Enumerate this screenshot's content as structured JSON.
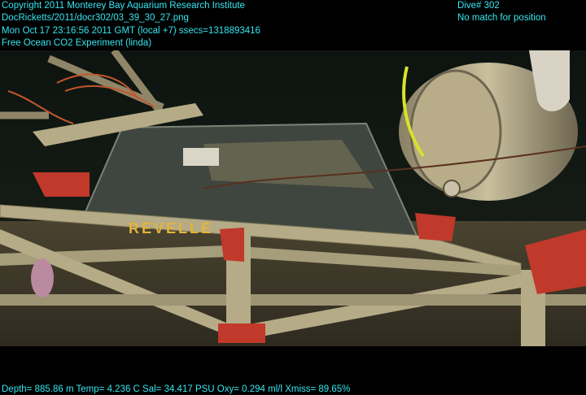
{
  "overlay": {
    "copyright": "Copyright 2011 Monterey Bay Aquarium Research Institute",
    "file": "DocRicketts/2011/docr302/03_39_30_27.png",
    "datetime": "Mon Oct 17 23:16:56 2011 GMT (local +7)  ssecs=1318893416",
    "experiment": "Free Ocean CO2 Experiment (linda)",
    "dive": "Dive# 302",
    "position": "No match for position",
    "sensors": "Depth= 885.86 m  Temp= 4.236 C  Sal= 34.417 PSU  Oxy= 0.294 ml/l  Xmiss= 89.65%"
  },
  "scene": {
    "label_text": "REVELLE",
    "colors": {
      "overlay_text": "#35e6ef",
      "frame": "#b5ab86",
      "frame_shadow": "#7d7558",
      "bracket": "#c0392b",
      "seafloor": "#3a3526",
      "water": "#101714"
    }
  }
}
